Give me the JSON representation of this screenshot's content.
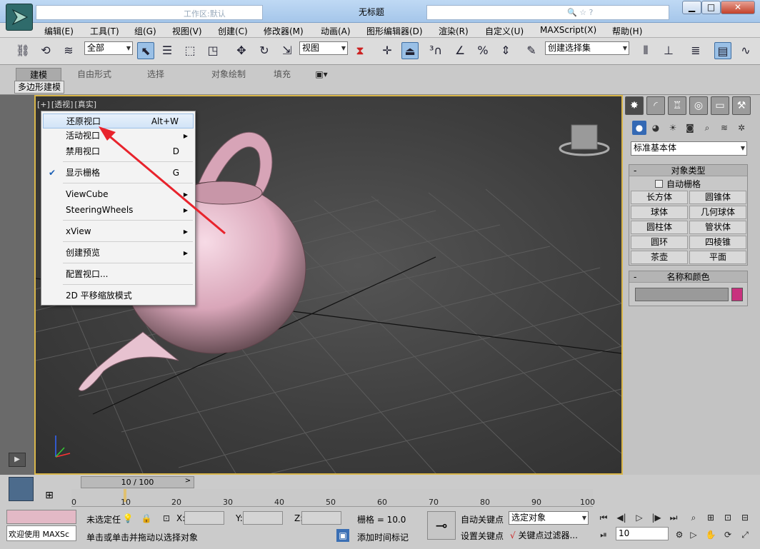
{
  "window": {
    "title": "无标题",
    "qa_text": "工作区:默认"
  },
  "menus": [
    "编辑(E)",
    "工具(T)",
    "组(G)",
    "视图(V)",
    "创建(C)",
    "修改器(M)",
    "动画(A)",
    "图形编辑器(D)",
    "渲染(R)",
    "自定义(U)",
    "MAXScript(X)",
    "帮助(H)"
  ],
  "toolbar": {
    "selection_filter": "全部",
    "ref_coord": "视图",
    "named_selection": "创建选择集"
  },
  "ribbon": {
    "tabs": [
      "建模",
      "自由形式",
      "选择",
      "对象绘制",
      "填充"
    ],
    "panel": "多边形建模"
  },
  "viewport": {
    "labels": [
      "[+]",
      "[透视]",
      "[真实]"
    ]
  },
  "context_menu": {
    "items": [
      {
        "label": "还原视口",
        "shortcut": "Alt+W"
      },
      {
        "label": "活动视口",
        "shortcut": ""
      },
      {
        "label": "禁用视口",
        "shortcut": "D"
      },
      {
        "label": "显示栅格",
        "shortcut": "G"
      },
      {
        "label": "ViewCube",
        "shortcut": ""
      },
      {
        "label": "SteeringWheels",
        "shortcut": ""
      },
      {
        "label": "xView",
        "shortcut": ""
      },
      {
        "label": "创建预览",
        "shortcut": ""
      },
      {
        "label": "配置视口...",
        "shortcut": ""
      },
      {
        "label": "2D 平移缩放模式",
        "shortcut": ""
      }
    ]
  },
  "command_panel": {
    "dropdown": "标准基本体",
    "object_type": {
      "title": "对象类型",
      "autogrid": "自动栅格",
      "buttons": [
        "长方体",
        "圆锥体",
        "球体",
        "几何球体",
        "圆柱体",
        "管状体",
        "圆环",
        "四棱锥",
        "茶壶",
        "平面"
      ]
    },
    "name_color": {
      "title": "名称和颜色",
      "swatch": "#c8327e"
    }
  },
  "timeline": {
    "frame": "10 / 100",
    "ticks": [
      "0",
      "10",
      "20",
      "30",
      "40",
      "50",
      "60",
      "70",
      "80",
      "90",
      "100"
    ]
  },
  "status": {
    "welcome": "欢迎使用 MAXSc",
    "selection": "未选定任",
    "prompt": "单击或单击并拖动以选择对象",
    "x_label": "X:",
    "y_label": "Y:",
    "z_label": "Z:",
    "grid": "栅格 = 10.0",
    "add_tag": "添加时间标记",
    "auto_key": "自动关键点",
    "set_key": "设置关键点",
    "key_mode": "选定对象",
    "key_filters": "关键点过滤器...",
    "current_frame": "10"
  }
}
